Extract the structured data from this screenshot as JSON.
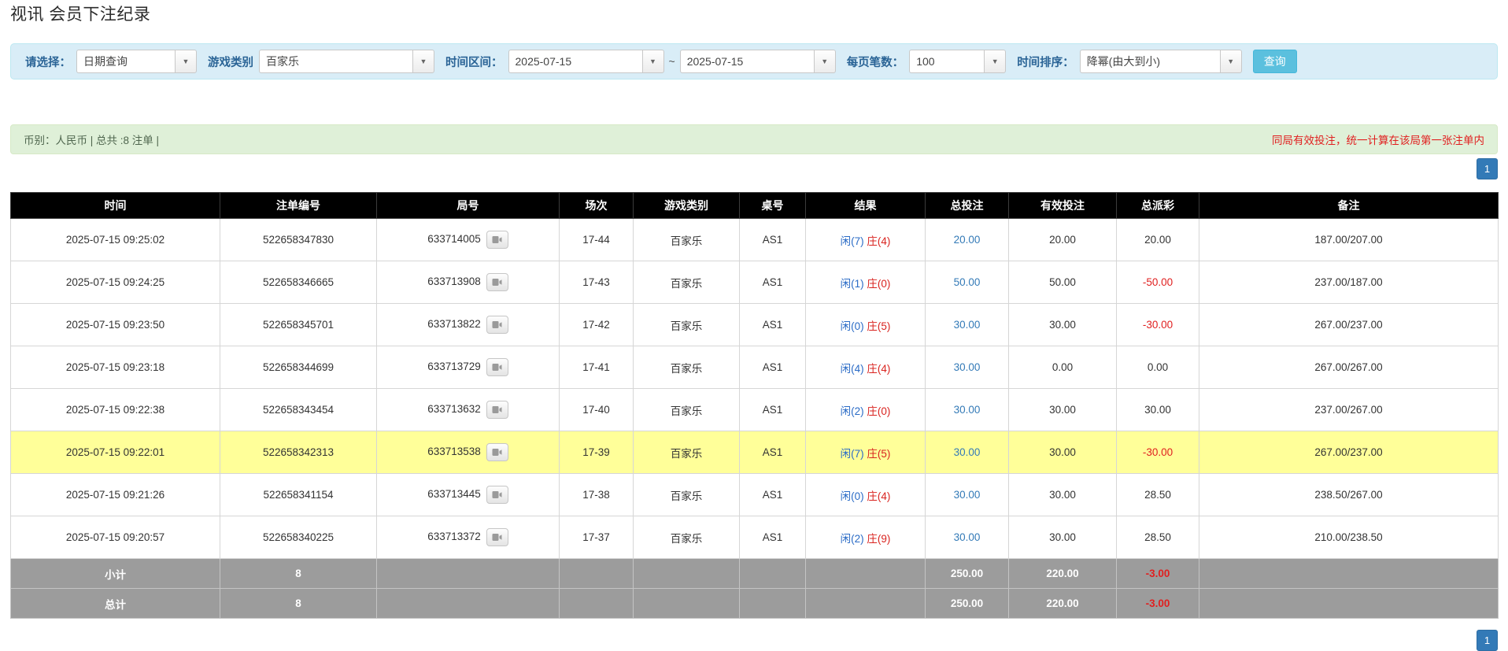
{
  "page": {
    "title": "视讯 会员下注纪录"
  },
  "colors": {
    "accent": "#337ab7",
    "filter_bar_bg": "#d9edf7",
    "info_bar_bg": "#dff0d8",
    "header_bg": "#000000",
    "highlight_row": "#ffff99",
    "summary_bg": "#9c9c9c",
    "negative_red": "#e02020",
    "player_blue": "#2a6bc6",
    "banker_red": "#d9231f",
    "search_button_bg": "#5bc0de"
  },
  "filter_bar": {
    "select_label": "请选择：",
    "select_value": "日期查询",
    "game_label": "游戏类别",
    "game_value": "百家乐",
    "range_label": "时间区间：",
    "date_from": "2025-07-15",
    "range_separator": "~",
    "date_to": "2025-07-15",
    "page_size_label": "每页笔数：",
    "page_size_value": "100",
    "sort_label": "时间排序：",
    "sort_value": "降幂(由大到小)",
    "search_button_label": "查询"
  },
  "info_bar": {
    "summary_text": "币别：人民币 | 总共 :8 注单 |",
    "notice_text": "同局有效投注，统一计算在该局第一张注单内"
  },
  "pagination": {
    "top_page": "1",
    "bottom_page": "1"
  },
  "table": {
    "headers": [
      "时间",
      "注单编号",
      "局号",
      "场次",
      "游戏类别",
      "桌号",
      "结果",
      "总投注",
      "有效投注",
      "总派彩",
      "备注"
    ],
    "icons": {
      "round_replay": "video-camera-icon"
    },
    "rows": [
      {
        "time": "2025-07-15 09:25:02",
        "bet_id": "522658347830",
        "round_id": "633714005",
        "session": "17-44",
        "game_type": "百家乐",
        "table_no": "AS1",
        "result_player": "闲(7)",
        "result_banker": "庄(4)",
        "total_bet": "20.00",
        "valid_bet": "20.00",
        "payout": "20.00",
        "remark": "187.00/207.00",
        "highlight": false
      },
      {
        "time": "2025-07-15 09:24:25",
        "bet_id": "522658346665",
        "round_id": "633713908",
        "session": "17-43",
        "game_type": "百家乐",
        "table_no": "AS1",
        "result_player": "闲(1)",
        "result_banker": "庄(0)",
        "total_bet": "50.00",
        "valid_bet": "50.00",
        "payout": "-50.00",
        "remark": "237.00/187.00",
        "highlight": false
      },
      {
        "time": "2025-07-15 09:23:50",
        "bet_id": "522658345701",
        "round_id": "633713822",
        "session": "17-42",
        "game_type": "百家乐",
        "table_no": "AS1",
        "result_player": "闲(0)",
        "result_banker": "庄(5)",
        "total_bet": "30.00",
        "valid_bet": "30.00",
        "payout": "-30.00",
        "remark": "267.00/237.00",
        "highlight": false
      },
      {
        "time": "2025-07-15 09:23:18",
        "bet_id": "522658344699",
        "round_id": "633713729",
        "session": "17-41",
        "game_type": "百家乐",
        "table_no": "AS1",
        "result_player": "闲(4)",
        "result_banker": "庄(4)",
        "total_bet": "30.00",
        "valid_bet": "0.00",
        "payout": "0.00",
        "remark": "267.00/267.00",
        "highlight": false
      },
      {
        "time": "2025-07-15 09:22:38",
        "bet_id": "522658343454",
        "round_id": "633713632",
        "session": "17-40",
        "game_type": "百家乐",
        "table_no": "AS1",
        "result_player": "闲(2)",
        "result_banker": "庄(0)",
        "total_bet": "30.00",
        "valid_bet": "30.00",
        "payout": "30.00",
        "remark": "237.00/267.00",
        "highlight": false
      },
      {
        "time": "2025-07-15 09:22:01",
        "bet_id": "522658342313",
        "round_id": "633713538",
        "session": "17-39",
        "game_type": "百家乐",
        "table_no": "AS1",
        "result_player": "闲(7)",
        "result_banker": "庄(5)",
        "total_bet": "30.00",
        "valid_bet": "30.00",
        "payout": "-30.00",
        "remark": "267.00/237.00",
        "highlight": true
      },
      {
        "time": "2025-07-15 09:21:26",
        "bet_id": "522658341154",
        "round_id": "633713445",
        "session": "17-38",
        "game_type": "百家乐",
        "table_no": "AS1",
        "result_player": "闲(0)",
        "result_banker": "庄(4)",
        "total_bet": "30.00",
        "valid_bet": "30.00",
        "payout": "28.50",
        "remark": "238.50/267.00",
        "highlight": false
      },
      {
        "time": "2025-07-15 09:20:57",
        "bet_id": "522658340225",
        "round_id": "633713372",
        "session": "17-37",
        "game_type": "百家乐",
        "table_no": "AS1",
        "result_player": "闲(2)",
        "result_banker": "庄(9)",
        "total_bet": "30.00",
        "valid_bet": "30.00",
        "payout": "28.50",
        "remark": "210.00/238.50",
        "highlight": false
      }
    ],
    "summary_rows": [
      {
        "label": "小计",
        "count": "8",
        "total_bet": "250.00",
        "valid_bet": "220.00",
        "payout": "-3.00"
      },
      {
        "label": "总计",
        "count": "8",
        "total_bet": "250.00",
        "valid_bet": "220.00",
        "payout": "-3.00"
      }
    ]
  }
}
